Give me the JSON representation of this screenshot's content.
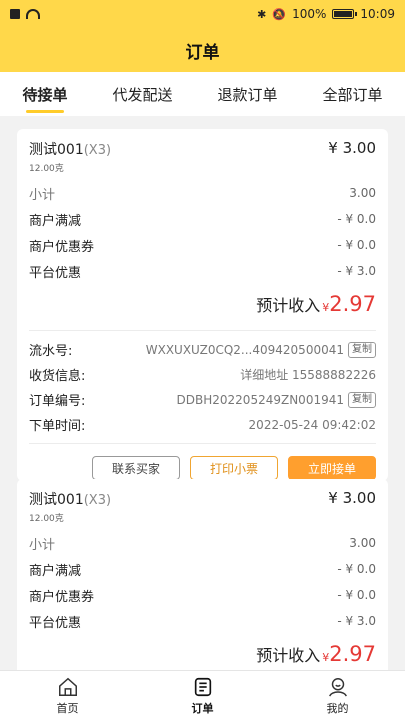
{
  "status": {
    "battery": "100%",
    "time": "10:09"
  },
  "header": {
    "title": "订单"
  },
  "tabs": [
    {
      "label": "待接单",
      "active": true
    },
    {
      "label": "代发配送",
      "active": false
    },
    {
      "label": "退款订单",
      "active": false
    },
    {
      "label": "全部订单",
      "active": false
    }
  ],
  "orders": [
    {
      "product_name": "测试001",
      "qty": "(X3)",
      "price": "¥ 3.00",
      "weight": "12.00克",
      "subtotal_label": "小计",
      "subtotal_value": "3.00",
      "merchant_discount_label": "商户满减",
      "merchant_discount_value": "- ¥ 0.0",
      "merchant_coupon_label": "商户优惠券",
      "merchant_coupon_value": "- ¥ 0.0",
      "platform_discount_label": "平台优惠",
      "platform_discount_value": "- ¥ 3.0",
      "income_label": "预计收入",
      "income_yen": "¥",
      "income_value": "2.97",
      "serial_label": "流水号:",
      "serial_value": "WXXUXUZ0CQ2...409420500041",
      "copy": "复制",
      "receiver_label": "收货信息:",
      "receiver_value": "详细地址 15588882226",
      "order_no_label": "订单编号:",
      "order_no_value": "DDBH202205249ZN001941",
      "time_label": "下单时间:",
      "time_value": "2022-05-24 09:42:02",
      "btn_contact": "联系买家",
      "btn_print": "打印小票",
      "btn_accept": "立即接单"
    },
    {
      "product_name": "测试001",
      "qty": "(X3)",
      "price": "¥ 3.00",
      "weight": "12.00克",
      "subtotal_label": "小计",
      "subtotal_value": "3.00",
      "merchant_discount_label": "商户满减",
      "merchant_discount_value": "- ¥ 0.0",
      "merchant_coupon_label": "商户优惠券",
      "merchant_coupon_value": "- ¥ 0.0",
      "platform_discount_label": "平台优惠",
      "platform_discount_value": "- ¥ 3.0",
      "income_label": "预计收入",
      "income_yen": "¥",
      "income_value": "2.97"
    }
  ],
  "nav": [
    {
      "label": "首页",
      "icon": "home-icon"
    },
    {
      "label": "订单",
      "icon": "order-icon"
    },
    {
      "label": "我的",
      "icon": "profile-icon"
    }
  ],
  "colors": {
    "accent": "#ffd84a",
    "price_red": "#e53935",
    "accept_orange": "#ff9f2e"
  }
}
